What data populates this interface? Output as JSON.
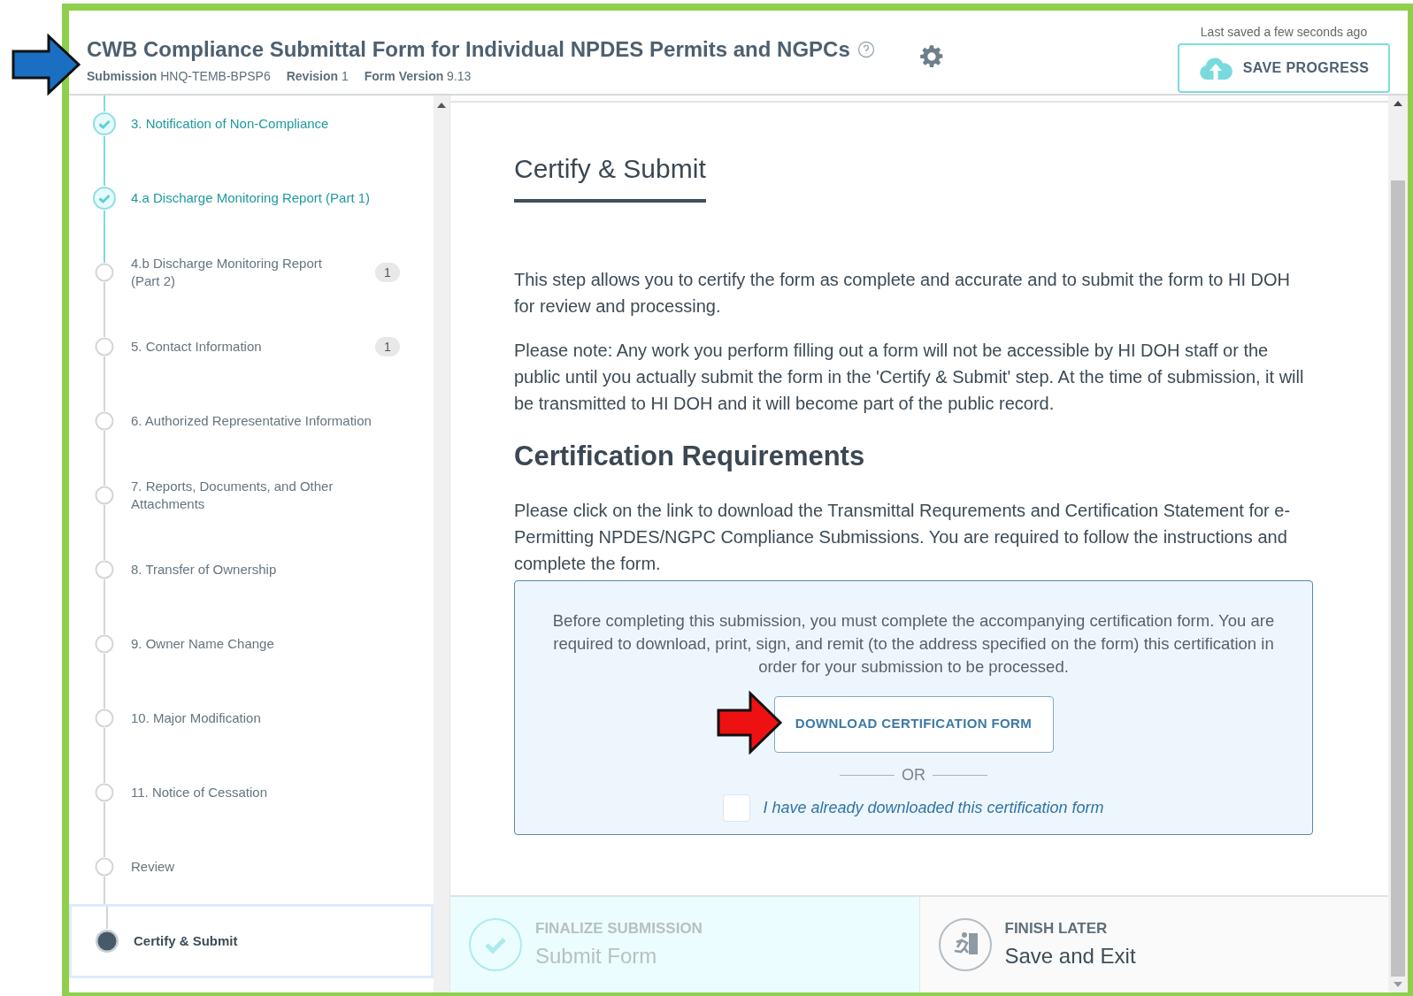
{
  "header": {
    "title": "CWB Compliance Submittal Form for Individual NPDES Permits and NGPCs",
    "meta": [
      {
        "label": "Submission",
        "value": "HNQ-TEMB-BPSP6"
      },
      {
        "label": "Revision",
        "value": "1"
      },
      {
        "label": "Form Version",
        "value": "9.13"
      }
    ],
    "last_saved": "Last saved a few seconds ago",
    "save_button": "SAVE PROGRESS"
  },
  "sidebar": {
    "steps": [
      {
        "label": "3. Notification of Non-Compliance",
        "completed": true,
        "selected": false
      },
      {
        "label": "4.a Discharge Monitoring Report (Part 1)",
        "completed": true,
        "selected": false
      },
      {
        "label": "4.b Discharge Monitoring Report (Part 2)",
        "completed": false,
        "selected": false,
        "badge": "1"
      },
      {
        "label": "5. Contact Information",
        "completed": false,
        "selected": false,
        "badge": "1"
      },
      {
        "label": "6. Authorized Representative Information",
        "completed": false,
        "selected": false
      },
      {
        "label": "7. Reports, Documents, and Other Attachments",
        "completed": false,
        "selected": false
      },
      {
        "label": "8. Transfer of Ownership",
        "completed": false,
        "selected": false
      },
      {
        "label": "9. Owner Name Change",
        "completed": false,
        "selected": false
      },
      {
        "label": "10. Major Modification",
        "completed": false,
        "selected": false
      },
      {
        "label": "11. Notice of Cessation",
        "completed": false,
        "selected": false
      },
      {
        "label": "Review",
        "completed": false,
        "selected": false
      },
      {
        "label": "Certify & Submit",
        "completed": false,
        "selected": true
      }
    ]
  },
  "main": {
    "heading": "Certify & Submit",
    "paragraphs": [
      "This step allows you to certify the form as complete and accurate and to submit the form to HI DOH for review and processing.",
      "Please note: Any work you perform filling out a form will not be accessible by HI DOH staff or the public until you actually submit the form in the 'Certify & Submit' step. At the time of submission, it will be transmitted to HI DOH and it will become part of the public record."
    ],
    "section_heading": "Certification Requirements",
    "instructions": "Please click on the link to download the Transmittal Requrements and Certification Statement for e-Permitting NPDES/NGPC Compliance Submissions.  You are required to follow the instructions and complete the form.",
    "notice": {
      "text": "Before completing this submission, you must complete the accompanying certification form. You are required to download, print, sign, and remit (to the address specified on the form) this certification in order for your submission to be processed.",
      "download_button": "DOWNLOAD CERTIFICATION FORM",
      "divider": "OR",
      "checkbox": {
        "label": "I have already downloaded this certification form",
        "checked": false
      }
    }
  },
  "footer": {
    "actions": [
      {
        "kind": "finalize",
        "eyebrow": "FINALIZE SUBMISSION",
        "label": "Submit Form",
        "disabled": true
      },
      {
        "kind": "later",
        "eyebrow": "FINISH LATER",
        "label": "Save and Exit",
        "disabled": false
      }
    ]
  }
}
